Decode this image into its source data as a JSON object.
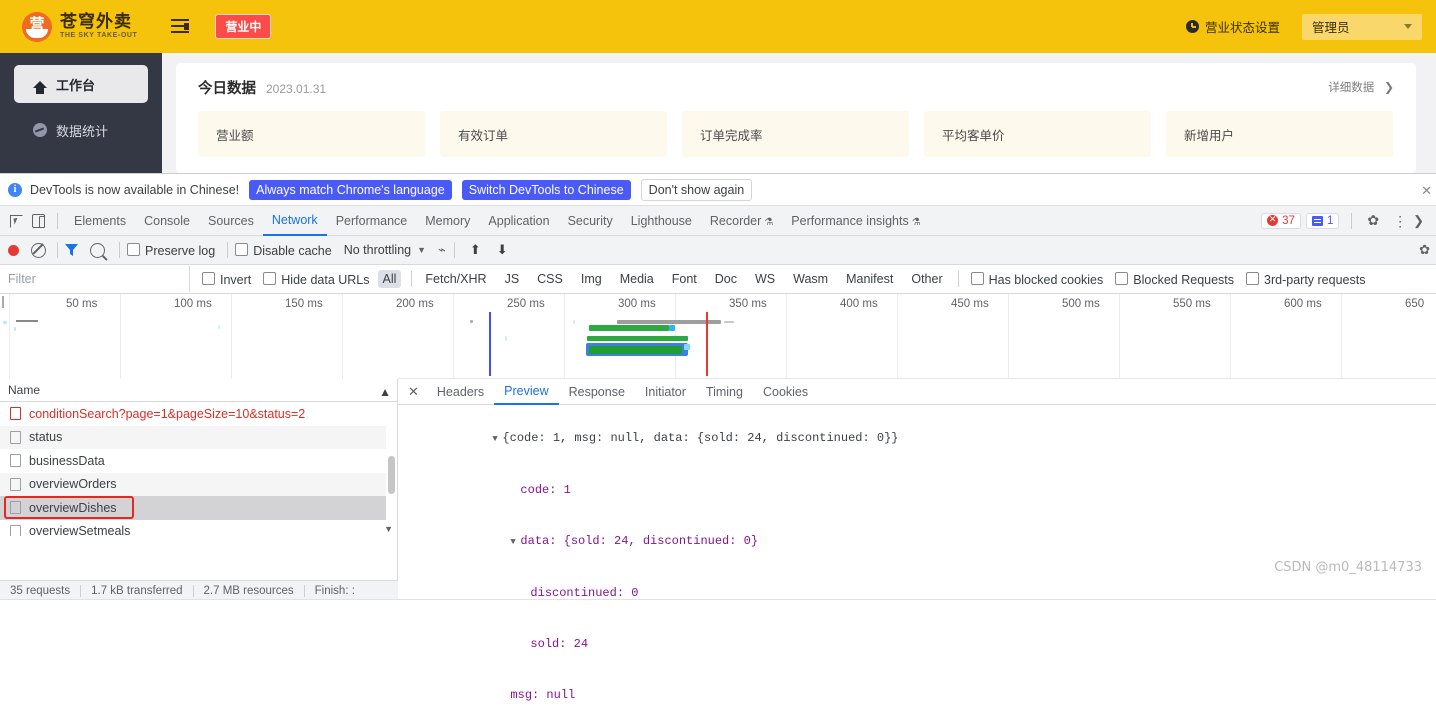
{
  "webapp": {
    "brand": {
      "cn": "苍穹外卖",
      "en": "THE SKY TAKE-OUT",
      "glyph": "营"
    },
    "status_chip": "营业中",
    "biz_status_setting": "营业状态设置",
    "user_role": "管理员",
    "sidebar": [
      {
        "label": "工作台",
        "icon": "home-icon",
        "active": true
      },
      {
        "label": "数据统计",
        "icon": "chart-icon",
        "active": false
      }
    ],
    "card": {
      "title": "今日数据",
      "date": "2023.01.31",
      "detail_link": "详细数据",
      "detail_chevron": "❯",
      "metrics": [
        {
          "label": "营业额"
        },
        {
          "label": "有效订单"
        },
        {
          "label": "订单完成率"
        },
        {
          "label": "平均客单价"
        },
        {
          "label": "新增用户"
        }
      ]
    }
  },
  "devtools": {
    "infobar": {
      "message": "DevTools is now available in Chinese!",
      "buttons": [
        {
          "label": "Always match Chrome's language",
          "style": "primary"
        },
        {
          "label": "Switch DevTools to Chinese",
          "style": "primary"
        },
        {
          "label": "Don't show again",
          "style": "plain"
        }
      ],
      "close": "✕"
    },
    "tabs": [
      {
        "label": "Elements",
        "active": false
      },
      {
        "label": "Console",
        "active": false
      },
      {
        "label": "Sources",
        "active": false
      },
      {
        "label": "Network",
        "active": true
      },
      {
        "label": "Performance",
        "active": false
      },
      {
        "label": "Memory",
        "active": false
      },
      {
        "label": "Application",
        "active": false
      },
      {
        "label": "Security",
        "active": false
      },
      {
        "label": "Lighthouse",
        "active": false
      },
      {
        "label": "Recorder",
        "active": false,
        "flask": "⚗"
      },
      {
        "label": "Performance insights",
        "active": false,
        "flask": "⚗"
      }
    ],
    "badges": {
      "errors": "37",
      "messages": "1"
    },
    "controls": {
      "preserve_log": "Preserve log",
      "disable_cache": "Disable cache",
      "throttling": "No throttling",
      "caret": "▼"
    },
    "filter": {
      "placeholder": "Filter",
      "value": "",
      "invert": "Invert",
      "hide_data_urls": "Hide data URLs",
      "types": [
        "All",
        "Fetch/XHR",
        "JS",
        "CSS",
        "Img",
        "Media",
        "Font",
        "Doc",
        "WS",
        "Wasm",
        "Manifest",
        "Other"
      ],
      "selected_type": "All",
      "has_blocked_cookies": "Has blocked cookies",
      "blocked_requests": "Blocked Requests",
      "third_party": "3rd-party requests"
    },
    "timeline": {
      "ticks": [
        "50 ms",
        "100 ms",
        "150 ms",
        "200 ms",
        "250 ms",
        "300 ms",
        "350 ms",
        "400 ms",
        "450 ms",
        "500 ms",
        "550 ms",
        "600 ms",
        "650"
      ]
    },
    "requests": {
      "column_header": "Name",
      "rows": [
        {
          "name": "conditionSearch?page=1&pageSize=10&status=2",
          "error": true,
          "selected": false
        },
        {
          "name": "status",
          "error": false,
          "selected": false
        },
        {
          "name": "businessData",
          "error": false,
          "selected": false
        },
        {
          "name": "overviewOrders",
          "error": false,
          "selected": false
        },
        {
          "name": "overviewDishes",
          "error": false,
          "selected": true
        },
        {
          "name": "overviewSetmeals",
          "error": false,
          "selected": false
        }
      ]
    },
    "statusbar": {
      "requests": "35 requests",
      "transferred": "1.7 kB transferred",
      "resources": "2.7 MB resources",
      "finish": "Finish: :"
    },
    "detail": {
      "tabs": [
        {
          "label": "Headers",
          "active": false
        },
        {
          "label": "Preview",
          "active": true
        },
        {
          "label": "Response",
          "active": false
        },
        {
          "label": "Initiator",
          "active": false
        },
        {
          "label": "Timing",
          "active": false
        },
        {
          "label": "Cookies",
          "active": false
        }
      ],
      "close": "✕",
      "preview": {
        "root_summary": "{code: 1, msg: null, data: {sold: 24, discontinued: 0}}",
        "lines": [
          {
            "indent": 0,
            "tri": "▼",
            "text": "{code: 1, msg: null, data: {sold: 24, discontinued: 0}}"
          },
          {
            "indent": 1,
            "tri": "",
            "text": "code: 1"
          },
          {
            "indent": 1,
            "tri": "▼",
            "text": "data: {sold: 24, discontinued: 0}"
          },
          {
            "indent": 2,
            "tri": "",
            "text": "discontinued: 0"
          },
          {
            "indent": 2,
            "tri": "",
            "text": "sold: 24"
          },
          {
            "indent": 1,
            "tri": "",
            "text": "msg: null"
          }
        ],
        "values": {
          "code": "1",
          "msg": "null",
          "sold": "24",
          "discontinued": "0"
        }
      }
    }
  },
  "watermark": "CSDN @m0_48114733",
  "colors": {
    "brand_yellow": "#f5c30b",
    "sidebar_dark": "#343744",
    "accent_blue": "#1a73e8",
    "error_red": "#d93025",
    "chip_red": "#fa4c48"
  }
}
